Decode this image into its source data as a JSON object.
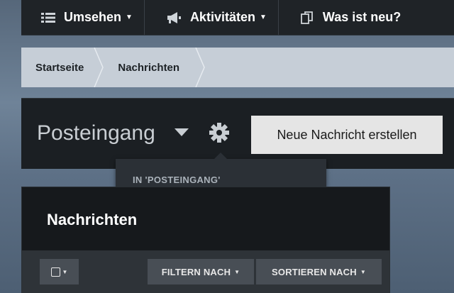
{
  "topnav": {
    "items": [
      {
        "label": "Umsehen",
        "icon": "list-icon",
        "has_caret": true
      },
      {
        "label": "Aktivitäten",
        "icon": "megaphone-icon",
        "has_caret": true
      },
      {
        "label": "Was ist neu?",
        "icon": "copy-icon",
        "has_caret": false
      }
    ],
    "caret": "▼"
  },
  "breadcrumb": [
    "Startseite",
    "Nachrichten"
  ],
  "header": {
    "title": "Posteingang",
    "new_message_label": "Neue Nachricht erstellen"
  },
  "dropdown": {
    "section_label": "IN 'POSTEINGANG'"
  },
  "panel": {
    "title": "Nachrichten",
    "filter_label": "FILTERN NACH",
    "sort_label": "SORTIEREN NACH",
    "caret": "▼"
  },
  "colors": {
    "nav_bg": "#1f2327",
    "breadcrumb_bg": "#c6ced7",
    "button_bg": "#e5e5e5",
    "toolbar_button_bg": "#484e55"
  }
}
